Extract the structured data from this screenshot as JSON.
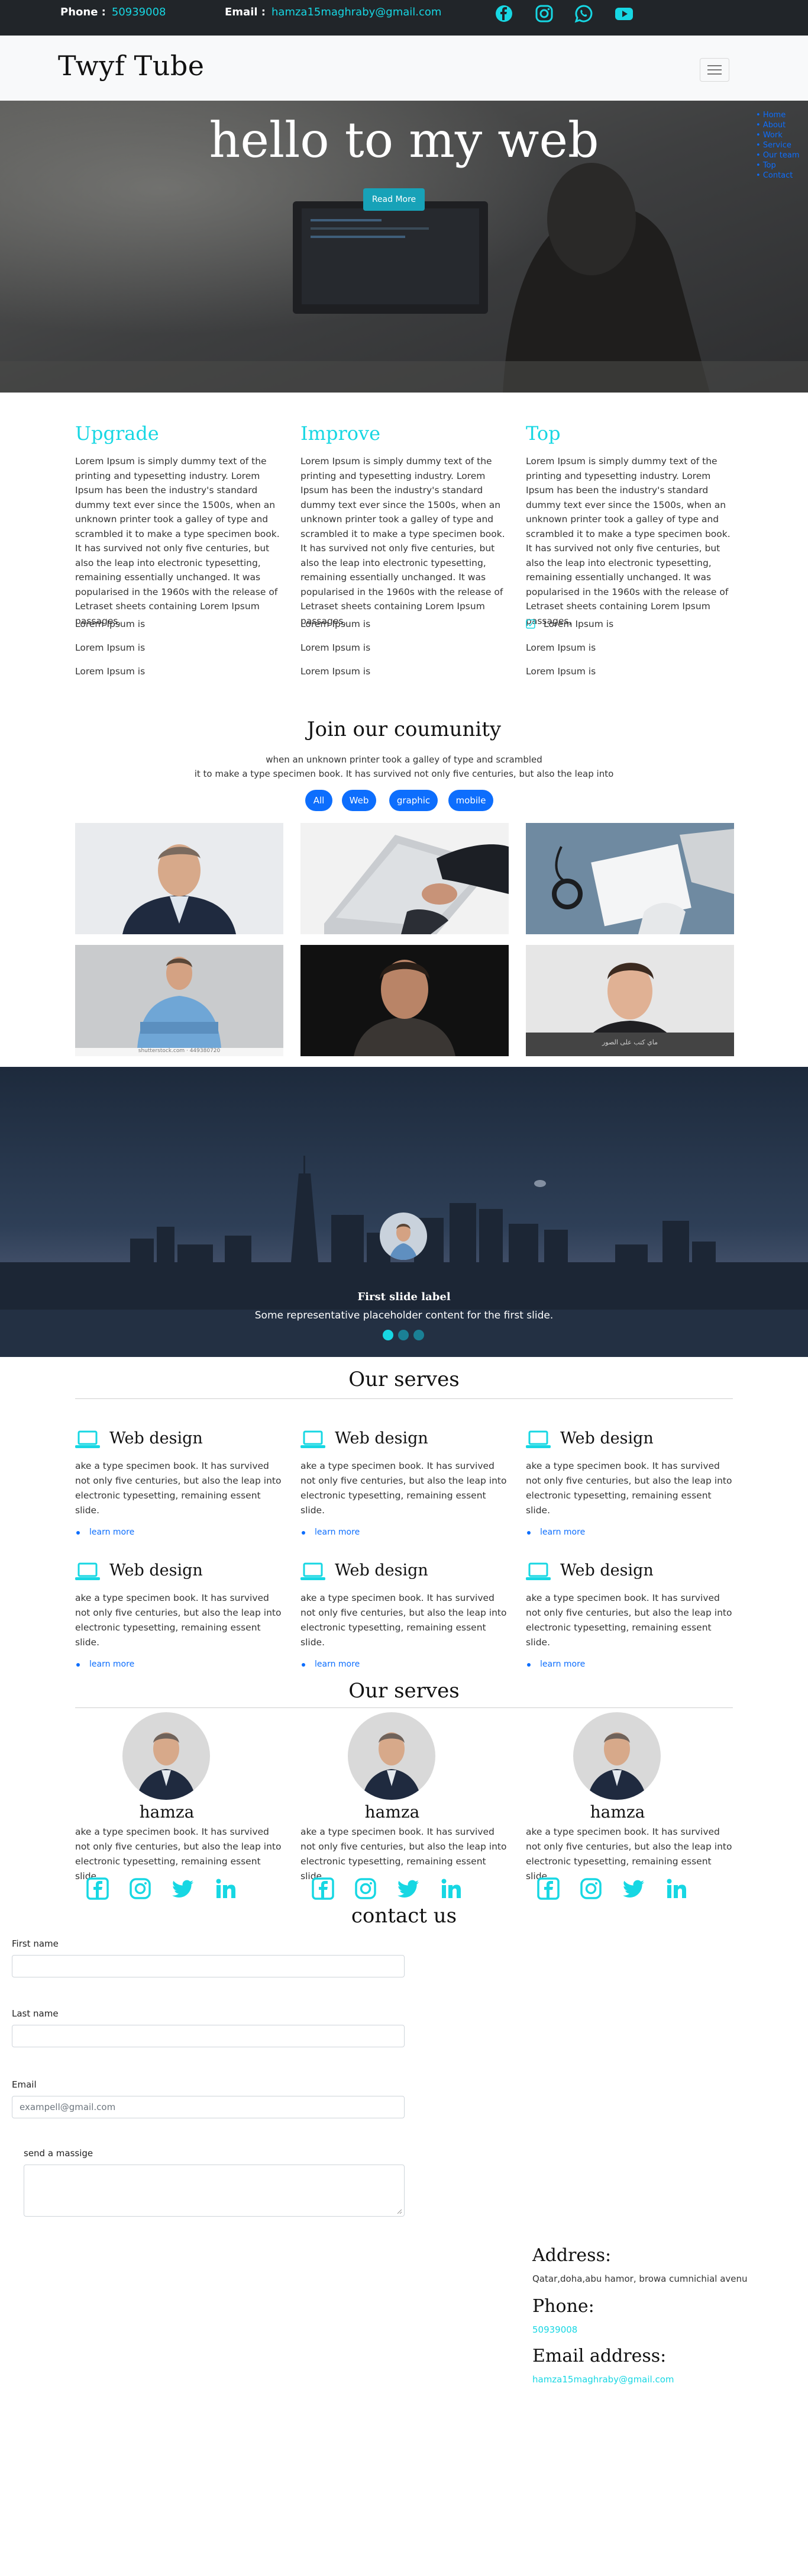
{
  "topbar": {
    "phone_label": "Phone :",
    "phone_value": "50939008",
    "email_label": "Email :",
    "email_value": "hamza15maghraby@gmail.com",
    "icons": [
      "facebook-icon",
      "instagram-icon",
      "whatsapp-icon",
      "youtube-icon"
    ],
    "accent": "#17d7e3"
  },
  "navbar": {
    "brand": "Twyf Tube"
  },
  "hero": {
    "title": "hello to my web",
    "button": "Read More",
    "menu": [
      "Home",
      "About",
      "Work",
      "Service",
      "Our team",
      "Top",
      "Contact"
    ]
  },
  "features": [
    {
      "title": "Upgrade",
      "text": "Lorem Ipsum is simply dummy text of the printing and typesetting industry. Lorem Ipsum has been the industry's standard dummy text ever since the 1500s, when an unknown printer took a galley of type and scrambled it to make a type specimen book. It has survived not only five centuries, but also the leap into electronic typesetting, remaining essentially unchanged. It was popularised in the 1960s with the release of Letraset sheets containing Lorem Ipsum passages,",
      "items": [
        "Lorem Ipsum is",
        "Lorem Ipsum is",
        "Lorem Ipsum is"
      ]
    },
    {
      "title": "Improve",
      "text": "Lorem Ipsum is simply dummy text of the printing and typesetting industry. Lorem Ipsum has been the industry's standard dummy text ever since the 1500s, when an unknown printer took a galley of type and scrambled it to make a type specimen book. It has survived not only five centuries, but also the leap into electronic typesetting, remaining essentially unchanged. It was popularised in the 1960s with the release of Letraset sheets containing Lorem Ipsum passages,",
      "items": [
        "Lorem Ipsum is",
        "Lorem Ipsum is",
        "Lorem Ipsum is"
      ]
    },
    {
      "title": "Top",
      "text": "Lorem Ipsum is simply dummy text of the printing and typesetting industry. Lorem Ipsum has been the industry's standard dummy text ever since the 1500s, when an unknown printer took a galley of type and scrambled it to make a type specimen book. It has survived not only five centuries, but also the leap into electronic typesetting, remaining essentially unchanged. It was popularised in the 1960s with the release of Letraset sheets containing Lorem Ipsum passages,",
      "items": [
        "Lorem Ipsum is",
        "Lorem Ipsum is",
        "Lorem Ipsum is"
      ]
    }
  ],
  "community": {
    "title": "Join our coumunity",
    "line1": "when an unknown printer took a galley of type and scrambled",
    "line2": "it to make a type specimen book. It has survived not only five centuries, but also the leap into",
    "filters": [
      "All",
      "Web",
      "graphic",
      "mobile"
    ],
    "photo_caption": "shutterstock.com · 449380720",
    "photo_overlay": "ماي كتب على الصور"
  },
  "carousel": {
    "caption_title": "First slide label",
    "caption_text": "Some representative placeholder content for the first slide.",
    "indicators": 3,
    "active_index": 0
  },
  "serves": {
    "title": "Our serves",
    "cards": [
      {
        "title": "Web design",
        "text": "ake a type specimen book. It has survived not only five centuries, but also the leap into electronic typesetting, remaining essent slide.",
        "link": "learn more"
      },
      {
        "title": "Web design",
        "text": "ake a type specimen book. It has survived not only five centuries, but also the leap into electronic typesetting, remaining essent slide.",
        "link": "learn more"
      },
      {
        "title": "Web design",
        "text": "ake a type specimen book. It has survived not only five centuries, but also the leap into electronic typesetting, remaining essent slide.",
        "link": "learn more"
      },
      {
        "title": "Web design",
        "text": "ake a type specimen book. It has survived not only five centuries, but also the leap into electronic typesetting, remaining essent slide.",
        "link": "learn more"
      },
      {
        "title": "Web design",
        "text": "ake a type specimen book. It has survived not only five centuries, but also the leap into electronic typesetting, remaining essent slide.",
        "link": "learn more"
      },
      {
        "title": "Web design",
        "text": "ake a type specimen book. It has survived not only five centuries, but also the leap into electronic typesetting, remaining essent slide.",
        "link": "learn more"
      }
    ]
  },
  "team": {
    "title": "Our serves",
    "members": [
      {
        "name": "hamza",
        "text": "ake a type specimen book. It has survived not only five centuries, but also the leap into electronic typesetting, remaining essent slide."
      },
      {
        "name": "hamza",
        "text": "ake a type specimen book. It has survived not only five centuries, but also the leap into electronic typesetting, remaining essent slide."
      },
      {
        "name": "hamza",
        "text": "ake a type specimen book. It has survived not only five centuries, but also the leap into electronic typesetting, remaining essent slide."
      }
    ],
    "social_icons": [
      "facebook-icon",
      "instagram-icon",
      "twitter-icon",
      "linkedin-icon"
    ]
  },
  "contact": {
    "title": "contact us",
    "first_name_label": "First name",
    "last_name_label": "Last name",
    "email_label": "Email",
    "email_placeholder": "exampell@gmail.com",
    "message_label": "send a massige"
  },
  "address": {
    "address_heading": "Address:",
    "address_text": "Qatar,doha,abu hamor, browa cumnichial avenu",
    "phone_heading": "Phone:",
    "phone_value": "50939008",
    "email_heading": "Email address:",
    "email_value": "hamza15maghraby@gmail.com"
  }
}
